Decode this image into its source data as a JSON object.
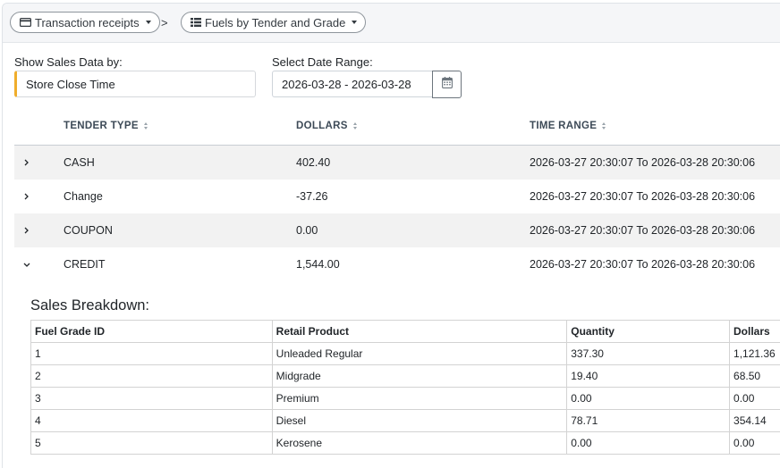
{
  "breadcrumb": {
    "first": "Transaction receipts",
    "separator": ">",
    "second": "Fuels by Tender and Grade"
  },
  "filters": {
    "show_sales_label": "Show Sales Data by:",
    "show_sales_value": "Store Close Time",
    "date_range_label": "Select Date Range:",
    "date_range_value": "2026-03-28 - 2026-03-28"
  },
  "table": {
    "headers": [
      "TENDER TYPE",
      "DOLLARS",
      "TIME RANGE"
    ],
    "rows": [
      {
        "tender": "CASH",
        "dollars": "402.40",
        "time_range": "2026-03-27 20:30:07 To 2026-03-28 20:30:06",
        "expanded": false
      },
      {
        "tender": "Change",
        "dollars": "-37.26",
        "time_range": "2026-03-27 20:30:07 To 2026-03-28 20:30:06",
        "expanded": false
      },
      {
        "tender": "COUPON",
        "dollars": "0.00",
        "time_range": "2026-03-27 20:30:07 To 2026-03-28 20:30:06",
        "expanded": false
      },
      {
        "tender": "CREDIT",
        "dollars": "1,544.00",
        "time_range": "2026-03-27 20:30:07 To 2026-03-28 20:30:06",
        "expanded": true
      }
    ]
  },
  "breakdown": {
    "title": "Sales Breakdown:",
    "headers": [
      "Fuel Grade ID",
      "Retail Product",
      "Quantity",
      "Dollars"
    ],
    "rows": [
      [
        "1",
        "Unleaded Regular",
        "337.30",
        "1,121.36"
      ],
      [
        "2",
        "Midgrade",
        "19.40",
        "68.50"
      ],
      [
        "3",
        "Premium",
        "0.00",
        "0.00"
      ],
      [
        "4",
        "Diesel",
        "78.71",
        "354.14"
      ],
      [
        "5",
        "Kerosene",
        "0.00",
        "0.00"
      ]
    ]
  },
  "colors": {
    "accent_border": "#f0ad2b",
    "striped_row": "#f2f2f2"
  },
  "icons": {
    "breadcrumb_first": "credit-card-icon",
    "breadcrumb_second": "list-icon",
    "date_button": "calendar-icon"
  }
}
